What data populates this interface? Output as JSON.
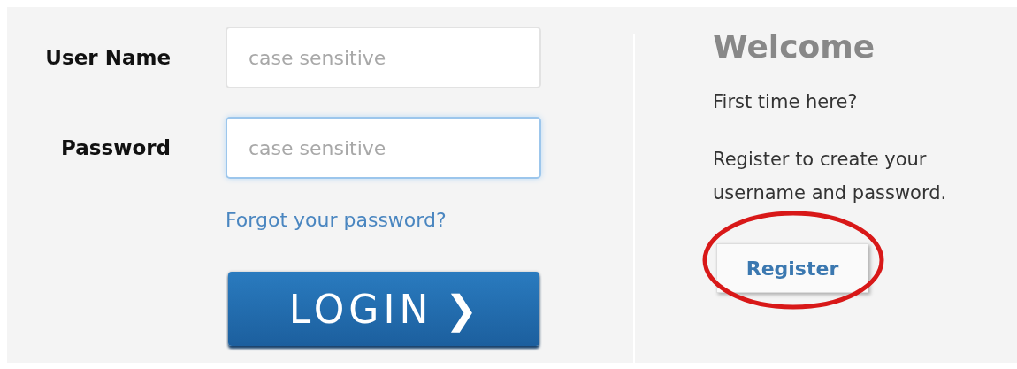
{
  "login_form": {
    "fields": [
      {
        "label": "User Name",
        "placeholder": "case sensitive",
        "focused": false
      },
      {
        "label": "Password",
        "placeholder": "case sensitive",
        "focused": true
      }
    ],
    "forgot_link": "Forgot your password?",
    "login_button": {
      "label": "LOGIN",
      "icon": "❯"
    }
  },
  "welcome": {
    "title": "Welcome",
    "question": "First time here?",
    "text": "Register to create your username and password.",
    "register_button": {
      "label": "Register",
      "circled": true
    }
  }
}
